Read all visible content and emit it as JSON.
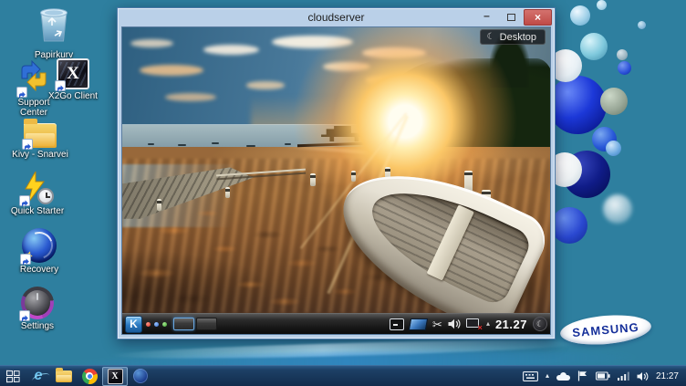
{
  "desktop": {
    "brand_logo": "SAMSUNG",
    "icons": [
      {
        "label": "Papirkurv"
      },
      {
        "label": "Support Center"
      },
      {
        "label": "X2Go Client"
      },
      {
        "label": "Kivy - Snarvei"
      },
      {
        "label": "Quick Starter"
      },
      {
        "label": "Recovery"
      },
      {
        "label": "Settings"
      }
    ]
  },
  "window": {
    "title": "cloudserver",
    "controls": {
      "minimize_glyph": "–",
      "close_glyph": "×"
    },
    "remote_desktop": {
      "toolbox": {
        "icon_glyph": "☾",
        "label": "Desktop"
      },
      "panel": {
        "kmenu_glyph": "K",
        "scissors_glyph": "✂",
        "network_error_glyph": "×",
        "expand_glyph": "▴",
        "clock": "21.27",
        "cashew_glyph": "☾"
      }
    }
  },
  "taskbar": {
    "ie_glyph": "e",
    "x2go_glyph": "X",
    "expand_glyph": "▴",
    "clock": "21:27"
  },
  "colors": {
    "close_button": "#bf4a46",
    "taskbar_blue": "#1d4066",
    "kmenu_blue": "#2a78c0",
    "samsung_text": "#16309a",
    "desktop_teal": "#2e7f9f"
  }
}
